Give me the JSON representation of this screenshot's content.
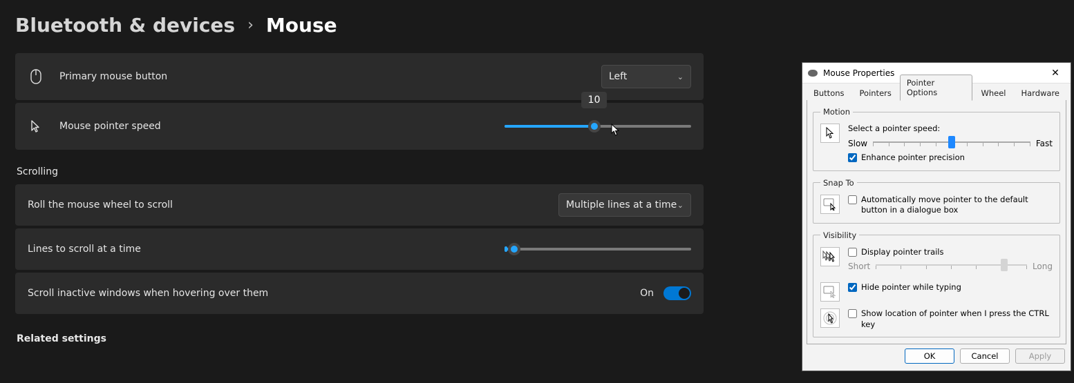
{
  "breadcrumb": {
    "parent": "Bluetooth & devices",
    "current": "Mouse"
  },
  "primary": {
    "label": "Primary mouse button",
    "value": "Left"
  },
  "pointer_speed": {
    "label": "Mouse pointer speed",
    "value": "10",
    "fill_pct": 48
  },
  "sections": {
    "scrolling": "Scrolling",
    "related": "Related settings"
  },
  "roll": {
    "label": "Roll the mouse wheel to scroll",
    "value": "Multiple lines at a time"
  },
  "lines": {
    "label": "Lines to scroll at a time",
    "fill_pct": 5
  },
  "inactive": {
    "label": "Scroll inactive windows when hovering over them",
    "state": "On"
  },
  "dlg": {
    "title": "Mouse Properties",
    "tabs": {
      "buttons": "Buttons",
      "pointers": "Pointers",
      "pointer_options": "Pointer Options",
      "wheel": "Wheel",
      "hardware": "Hardware"
    },
    "motion": {
      "legend": "Motion",
      "label": "Select a pointer speed:",
      "slow": "Slow",
      "fast": "Fast",
      "thumb_pct": 50,
      "enhance": "Enhance pointer precision",
      "enhance_checked": true
    },
    "snap": {
      "legend": "Snap To",
      "label": "Automatically move pointer to the default button in a dialogue box",
      "checked": false
    },
    "visibility": {
      "legend": "Visibility",
      "trails": {
        "label": "Display pointer trails",
        "checked": false,
        "short": "Short",
        "long": "Long",
        "thumb_pct": 85
      },
      "hide": {
        "label": "Hide pointer while typing",
        "checked": true
      },
      "ctrl": {
        "label": "Show location of pointer when I press the CTRL key",
        "checked": false
      }
    },
    "buttons": {
      "ok": "OK",
      "cancel": "Cancel",
      "apply": "Apply"
    }
  }
}
